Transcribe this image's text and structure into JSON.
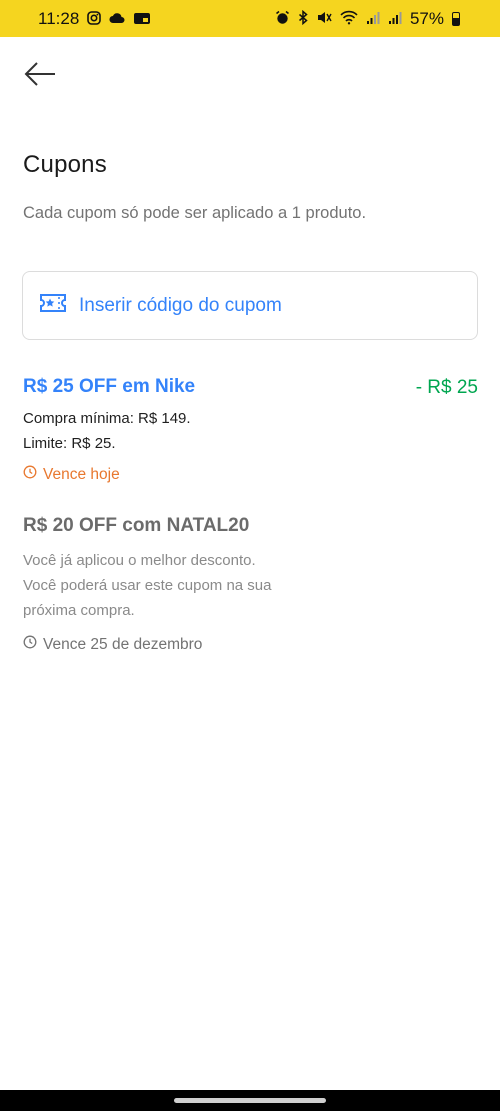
{
  "status_bar": {
    "time": "11:28",
    "battery": "57%"
  },
  "header": {
    "title": "Cupons",
    "subtitle": "Cada cupom só pode ser aplicado a 1 produto."
  },
  "coupon_input": {
    "label": "Inserir código do cupom",
    "icon": "coupon-ticket-icon"
  },
  "coupons": [
    {
      "title": "R$ 25 OFF em Nike",
      "discount": "- R$ 25",
      "lines": [
        "Compra mínima: R$ 149.",
        "Limite: R$ 25."
      ],
      "expires": "Vence hoje",
      "color": "#3483fa",
      "discount_color": "#00a650",
      "expires_color": "#e8782f"
    },
    {
      "title": "R$ 20 OFF com NATAL20",
      "lines": [
        "Você já aplicou o melhor desconto.",
        "Você poderá usar este cupom na sua",
        "próxima compra."
      ],
      "expires": "Vence 25 de dezembro",
      "color": "#6b6b6b",
      "expires_color": "#737373"
    }
  ],
  "colors": {
    "status_bar_bg": "#f5d51f",
    "accent": "#3483fa"
  }
}
